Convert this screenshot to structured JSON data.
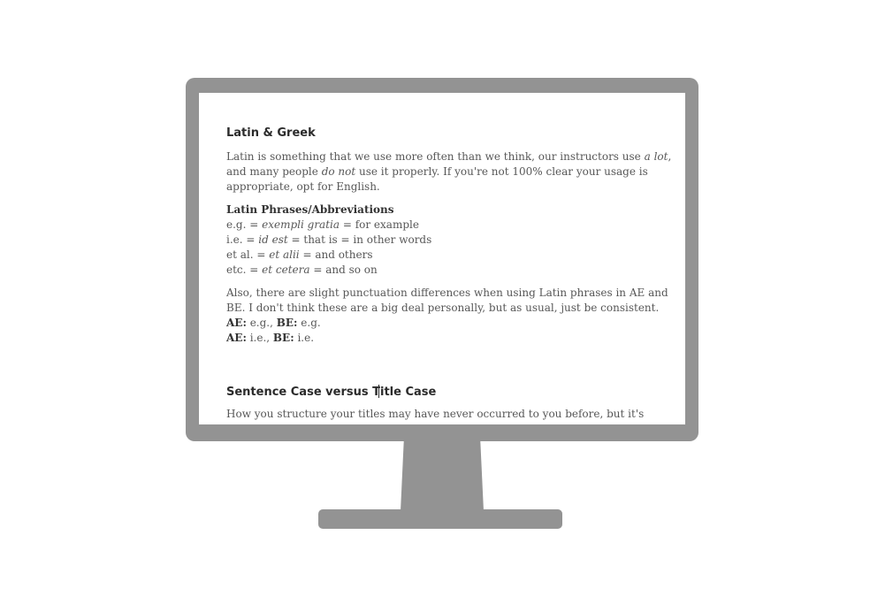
{
  "colors": {
    "frame": "#939393",
    "screen_bg": "#ffffff",
    "heading": "#2b2b2b",
    "body_text": "#575757"
  },
  "doc": {
    "section1_title": "Latin & Greek",
    "intro": {
      "p1": "Latin is something that we use more often than we think, our instructors use ",
      "p1_em": "a lot",
      "p2": ",",
      "p3": "and many people ",
      "p3_em": "do not",
      "p4": " use it properly. If you're not 100% clear your usage is",
      "p5": "appropriate, opt for English."
    },
    "phrases_title": "Latin Phrases/Abbreviations",
    "phrases": [
      {
        "abbr": "e.g. = ",
        "latin": "exempli gratia",
        "meaning": " = for example"
      },
      {
        "abbr": "i.e. = ",
        "latin": "id est",
        "meaning": " = that is = in other words"
      },
      {
        "abbr": "et al. = ",
        "latin": "et alii",
        "meaning": " = and others"
      },
      {
        "abbr": "etc. = ",
        "latin": "et cetera",
        "meaning": " = and so on"
      }
    ],
    "punct_line1": "Also, there are slight punctuation differences when using Latin phrases in AE and",
    "punct_line2": "BE. I don't think these are a big deal personally, but as usual, just be consistent.",
    "ae_label": "AE:",
    "be_label": "BE:",
    "ex1_ae": " e.g., ",
    "ex1_be": " e.g.",
    "ex2_ae": " i.e., ",
    "ex2_be": " i.e.",
    "section2_title_a": "Sentence Case versus T",
    "section2_title_b": "itle Case",
    "section2_p": "How you structure your titles may have never occurred to you before, but it's"
  }
}
